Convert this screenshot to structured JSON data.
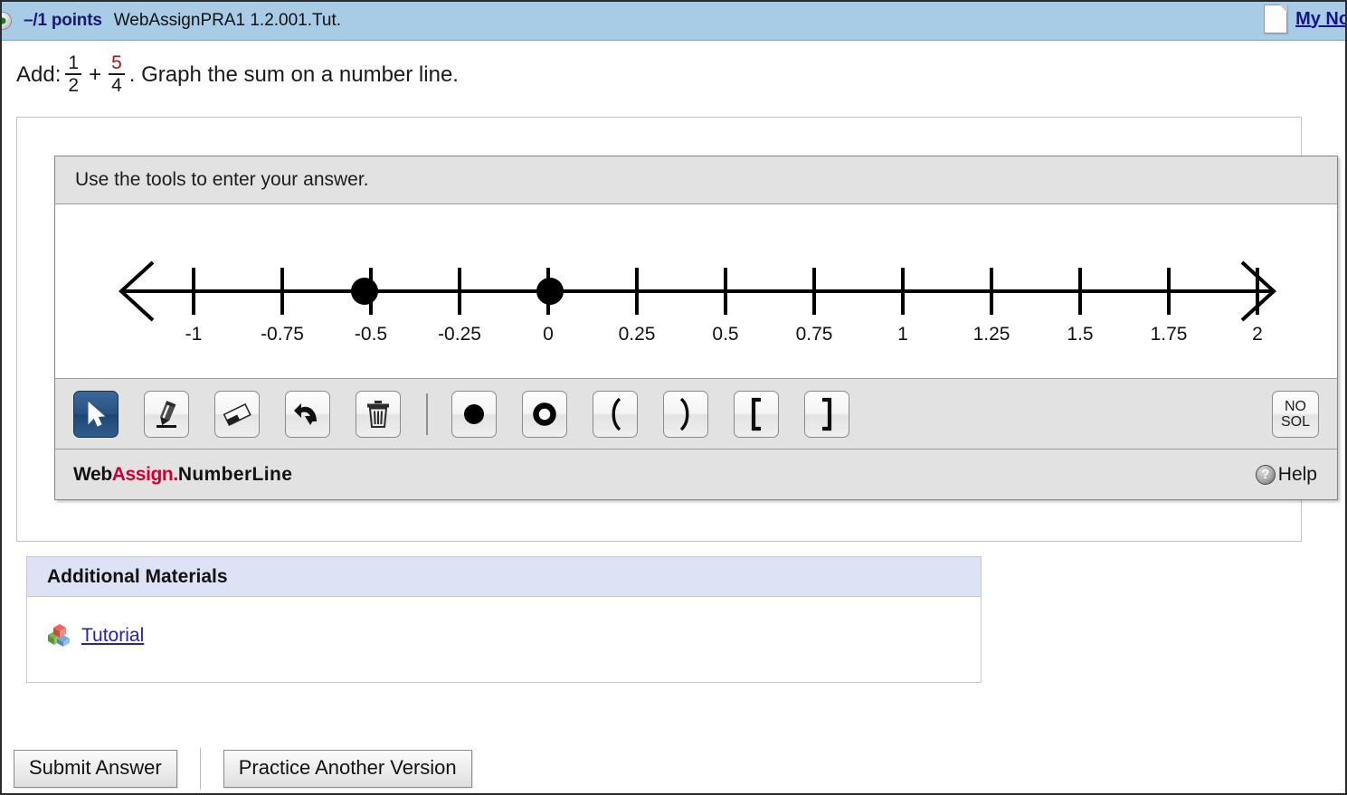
{
  "header": {
    "status_icon": "green-status-dot-icon",
    "points": "–/1 points",
    "question_code": "WebAssignPRA1 1.2.001.Tut.",
    "notes_icon": "note-page-icon",
    "notes_label": "My Notes"
  },
  "question": {
    "prefix": "Add:",
    "fraction1": {
      "numerator": "1",
      "denominator": "2"
    },
    "operator": "+",
    "fraction2": {
      "numerator": "5",
      "denominator": "4"
    },
    "suffix": ". Graph the sum on a number line.",
    "highlight_color": "#b01212"
  },
  "tool_panel": {
    "title": "Use the tools to enter your answer.",
    "toolbar": [
      {
        "name": "select-tool",
        "icon": "cursor-arrow-icon",
        "label": "Select",
        "active": true
      },
      {
        "name": "pencil-tool",
        "icon": "pencil-icon",
        "label": "Draw",
        "active": false
      },
      {
        "name": "eraser-tool",
        "icon": "eraser-icon",
        "label": "Erase",
        "active": false
      },
      {
        "name": "undo-tool",
        "icon": "undo-arrow-icon",
        "label": "Undo",
        "active": false
      },
      {
        "name": "delete-tool",
        "icon": "trash-can-icon",
        "label": "Delete All",
        "active": false
      },
      {
        "name": "closed-dot-tool",
        "icon": "filled-circle-icon",
        "label": "Closed Dot",
        "active": false
      },
      {
        "name": "open-dot-tool",
        "icon": "open-circle-icon",
        "label": "Open Dot",
        "active": false
      },
      {
        "name": "left-paren-tool",
        "icon": "left-parenthesis-icon",
        "label": "(",
        "active": false
      },
      {
        "name": "right-paren-tool",
        "icon": "right-parenthesis-icon",
        "label": ")",
        "active": false
      },
      {
        "name": "left-bracket-tool",
        "icon": "left-bracket-icon",
        "label": "[",
        "active": false
      },
      {
        "name": "right-bracket-tool",
        "icon": "right-bracket-icon",
        "label": "]",
        "active": false
      }
    ],
    "no_solution": {
      "line1": "NO",
      "line2": "SOL"
    },
    "brand": {
      "web": "Web",
      "assign": "Assign",
      "dot": ".",
      "product": "NumberLine"
    },
    "help": {
      "icon": "question-mark-circle-icon",
      "label": "Help"
    }
  },
  "chart_data": {
    "type": "number-line",
    "title": "",
    "xlabel": "",
    "xlim": [
      -1.25,
      2.25
    ],
    "tick_values": [
      -1,
      -0.75,
      -0.5,
      -0.25,
      0,
      0.25,
      0.5,
      0.75,
      1,
      1.25,
      1.5,
      1.75,
      2
    ],
    "tick_labels": [
      "-1",
      "-0.75",
      "-0.5",
      "-0.25",
      "0",
      "0.25",
      "0.5",
      "0.75",
      "1",
      "1.25",
      "1.5",
      "1.75",
      "2"
    ],
    "arrows": [
      "left",
      "right"
    ],
    "points": [
      {
        "value": -0.5,
        "style": "closed",
        "label": "-0.5"
      },
      {
        "value": 0,
        "style": "closed",
        "label": "0"
      }
    ],
    "grid": false,
    "legend": "none"
  },
  "additional_materials": {
    "heading": "Additional Materials",
    "items": [
      {
        "icon": "tutorial-blocks-icon",
        "label": "Tutorial"
      }
    ]
  },
  "footer_buttons": {
    "submit": "Submit Answer",
    "practice": "Practice Another Version"
  }
}
